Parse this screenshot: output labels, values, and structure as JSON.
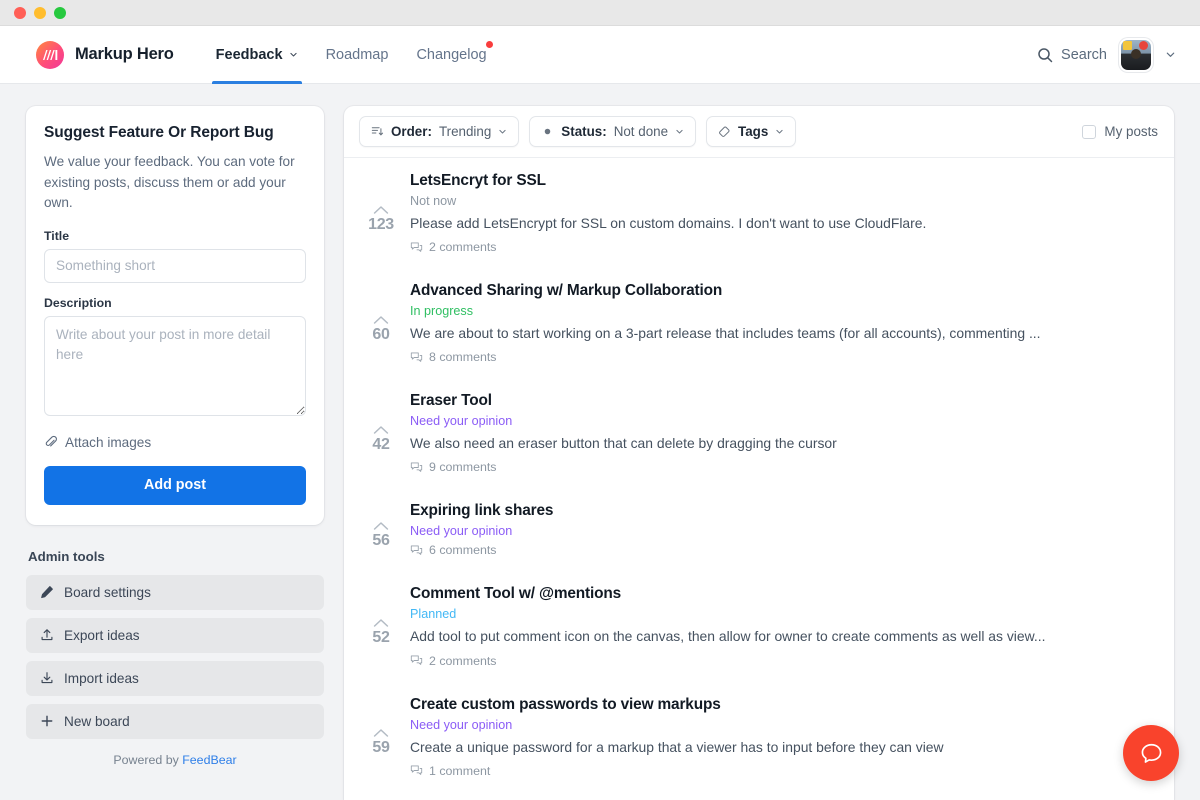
{
  "window": {
    "traffic_lights": [
      "close",
      "minimize",
      "zoom"
    ]
  },
  "header": {
    "brand": "Markup Hero",
    "brand_logo_icon": "markup-hero-logo-icon",
    "tabs": [
      {
        "label": "Feedback",
        "active": true,
        "has_caret": true,
        "has_notification": false
      },
      {
        "label": "Roadmap",
        "active": false,
        "has_caret": false,
        "has_notification": false
      },
      {
        "label": "Changelog",
        "active": false,
        "has_caret": false,
        "has_notification": true
      }
    ],
    "search_label": "Search",
    "search_icon": "search-icon",
    "avatar_icon": "user-avatar",
    "account_caret_icon": "chevron-down-icon"
  },
  "sidebar": {
    "form": {
      "title": "Suggest Feature Or Report Bug",
      "description": "We value your feedback. You can vote for existing posts, discuss them or add your own.",
      "title_field_label": "Title",
      "title_field_value": "",
      "title_field_placeholder": "Something short",
      "description_field_label": "Description",
      "description_field_value": "",
      "description_field_placeholder": "Write about your post in more detail here",
      "attach_label": "Attach images",
      "attach_icon": "paperclip-icon",
      "submit_label": "Add post"
    },
    "admin": {
      "heading": "Admin tools",
      "items": [
        {
          "label": "Board settings",
          "icon": "pencil-icon"
        },
        {
          "label": "Export ideas",
          "icon": "upload-icon"
        },
        {
          "label": "Import ideas",
          "icon": "download-icon"
        },
        {
          "label": "New board",
          "icon": "plus-icon"
        }
      ]
    },
    "footer": {
      "powered_prefix": "Powered by ",
      "powered_brand": "FeedBear"
    }
  },
  "filters": {
    "order": {
      "prefix": "Order:",
      "value": "Trending",
      "icon": "sort-icon"
    },
    "status": {
      "prefix": "Status:",
      "value": "Not done",
      "icon": "status-dot-icon"
    },
    "tags": {
      "label": "Tags",
      "icon": "tag-icon"
    },
    "my_posts": {
      "label": "My posts",
      "checked": false
    }
  },
  "status_colors": {
    "Not now": "#8d97a2",
    "In progress": "#2fbf62",
    "Need your opinion": "#8b5cf6",
    "Planned": "#43b8f5"
  },
  "posts": [
    {
      "votes": "123",
      "title": "LetsEncryt for SSL",
      "status": "Not now",
      "description": "Please add LetsEncrypt for SSL on custom domains. I don't want to use CloudFlare.",
      "comments": "2 comments"
    },
    {
      "votes": "60",
      "title": "Advanced Sharing w/ Markup Collaboration",
      "status": "In progress",
      "description": "We are about to start working on a 3-part release that includes teams (for all accounts), commenting ...",
      "comments": "8 comments"
    },
    {
      "votes": "42",
      "title": "Eraser Tool",
      "status": "Need your opinion",
      "description": "We also need an eraser button that can delete by dragging the cursor",
      "comments": "9 comments"
    },
    {
      "votes": "56",
      "title": "Expiring link shares",
      "status": "Need your opinion",
      "description": "",
      "comments": "6 comments"
    },
    {
      "votes": "52",
      "title": "Comment Tool w/ @mentions",
      "status": "Planned",
      "description": "Add tool to put comment icon on the canvas, then allow for owner to create comments as well as view...",
      "comments": "2 comments"
    },
    {
      "votes": "59",
      "title": "Create custom passwords to view markups",
      "status": "Need your opinion",
      "description": "Create a unique password for a markup that a viewer has to input before they can view",
      "comments": "1 comment"
    }
  ],
  "help_widget": {
    "icon": "chat-bubble-icon",
    "color": "#f9432c"
  },
  "theme": {
    "accent_blue": "#1273e6",
    "tab_underline": "#2b7fe0",
    "page_bg": "#f2f3f5"
  }
}
